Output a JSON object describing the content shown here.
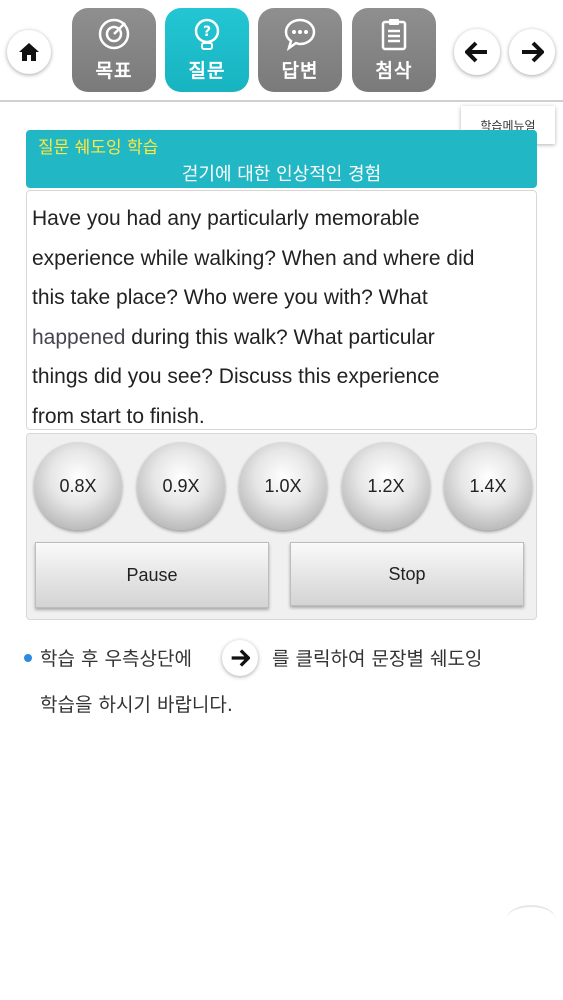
{
  "nav": {
    "home_icon": "home-icon",
    "tabs": [
      {
        "label": "목표",
        "icon": "target-icon"
      },
      {
        "label": "질문",
        "icon": "question-bulb-icon",
        "active": true
      },
      {
        "label": "답변",
        "icon": "speech-bubble-icon"
      },
      {
        "label": "첨삭",
        "icon": "clipboard-icon"
      }
    ],
    "prev_icon": "arrow-left-icon",
    "next_icon": "arrow-right-icon"
  },
  "manual_label": "학습메뉴얼",
  "title": {
    "sub": "질문 쉐도잉 학습",
    "main": "걷기에 대한 인상적인 경험"
  },
  "question": {
    "line1": "Have you had any particularly memorable",
    "line2": "experience while walking? When and where did",
    "line3": "this take place? Who were you with? What",
    "line4_highlight": "happened",
    "line4_rest": " during this walk? What particular",
    "line5": "things did you see? Discuss this experience",
    "line6": "from start to finish."
  },
  "speeds": [
    "0.8X",
    "0.9X",
    "1.0X",
    "1.2X",
    "1.4X"
  ],
  "controls": {
    "pause": "Pause",
    "stop": "Stop"
  },
  "note": {
    "before": "학습 후 우측상단에",
    "after": "를 클릭하여 문장별 쉐도잉",
    "line2": "학습을 하시기 바랍니다."
  },
  "colors": {
    "accent": "#22b7c4",
    "title_sub": "#ffe840",
    "tab_inactive": "#808080",
    "bullet": "#2b8be0"
  }
}
